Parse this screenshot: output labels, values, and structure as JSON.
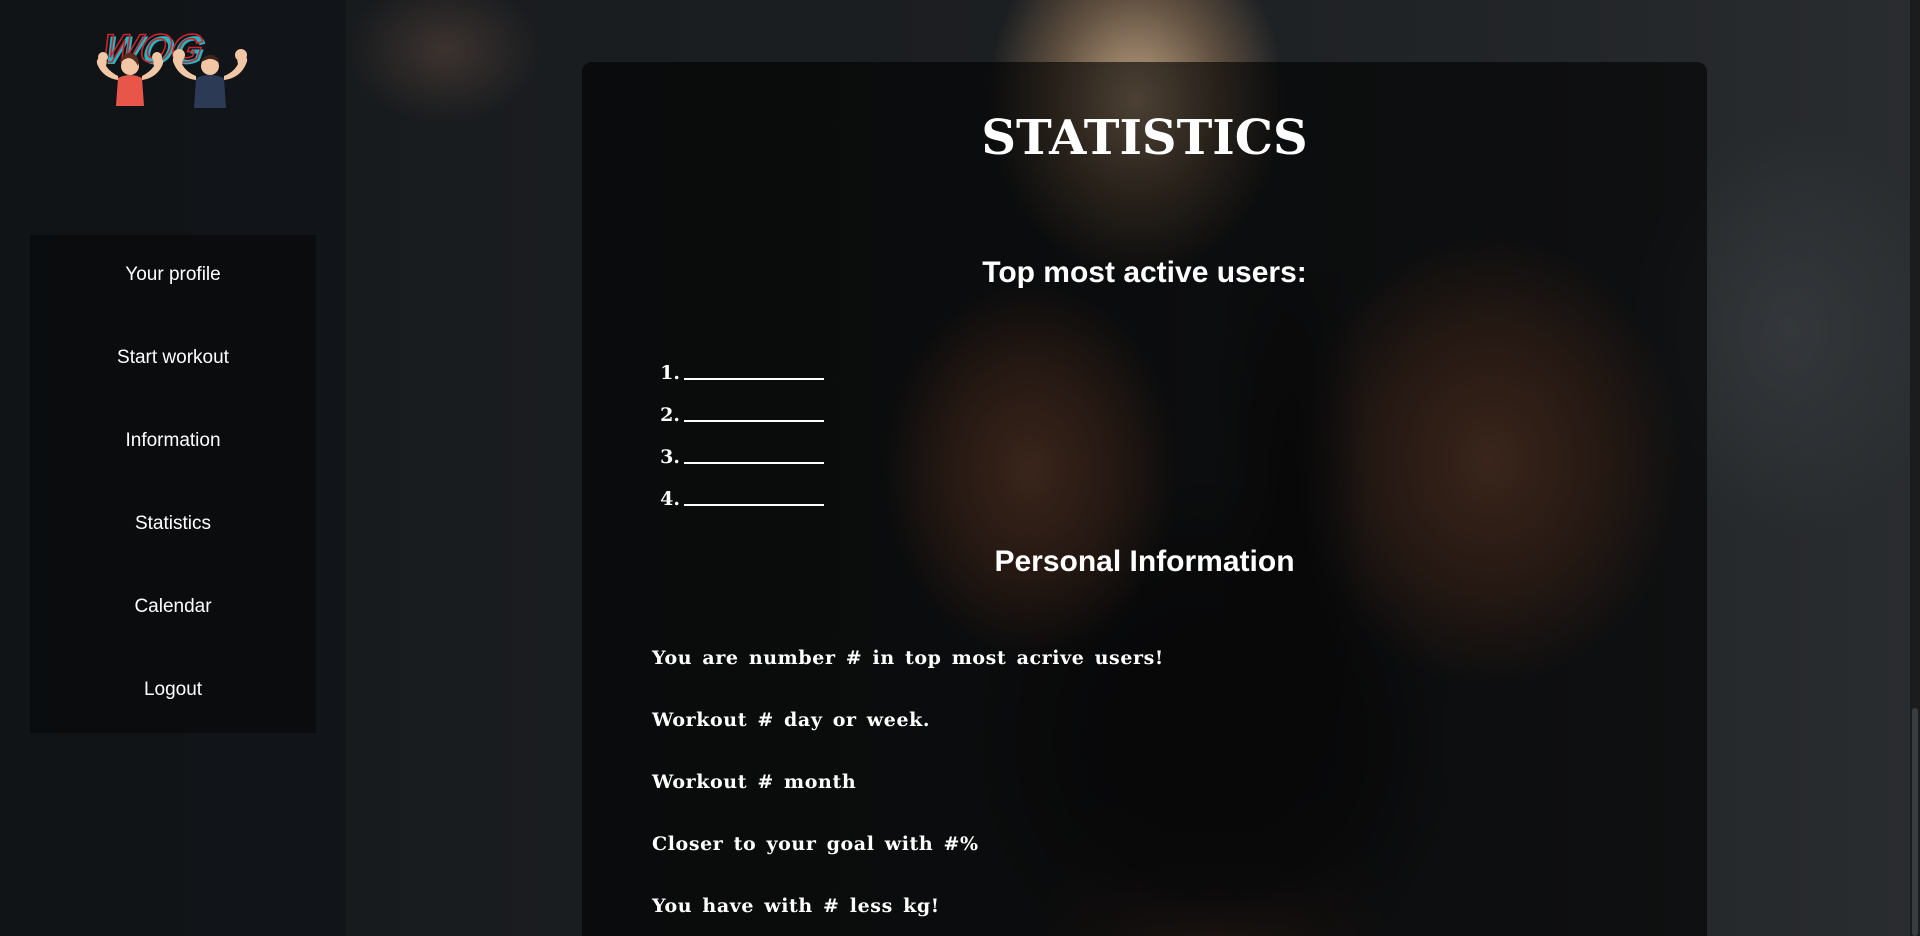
{
  "app": {
    "logo_text": "WOG"
  },
  "sidebar": {
    "items": [
      {
        "label": "Your profile"
      },
      {
        "label": "Start workout"
      },
      {
        "label": "Information"
      },
      {
        "label": "Statistics"
      },
      {
        "label": "Calendar"
      },
      {
        "label": "Logout"
      }
    ]
  },
  "main": {
    "title": "STATISTICS",
    "top_users": {
      "heading": "Top most active users:",
      "ranks": [
        {
          "number": "1."
        },
        {
          "number": "2."
        },
        {
          "number": "3."
        },
        {
          "number": "4."
        }
      ]
    },
    "personal": {
      "heading": "Personal Information",
      "lines": [
        "You are number # in top most acrive users!",
        "Workout # day or week.",
        "Workout # month",
        "Closer to your goal with #%",
        "You have with # less kg!"
      ]
    }
  },
  "colors": {
    "text": "#ffffff",
    "sidebar_bg": "#101417",
    "logo_red": "#d0222c",
    "logo_teal": "#1fb8c4"
  }
}
